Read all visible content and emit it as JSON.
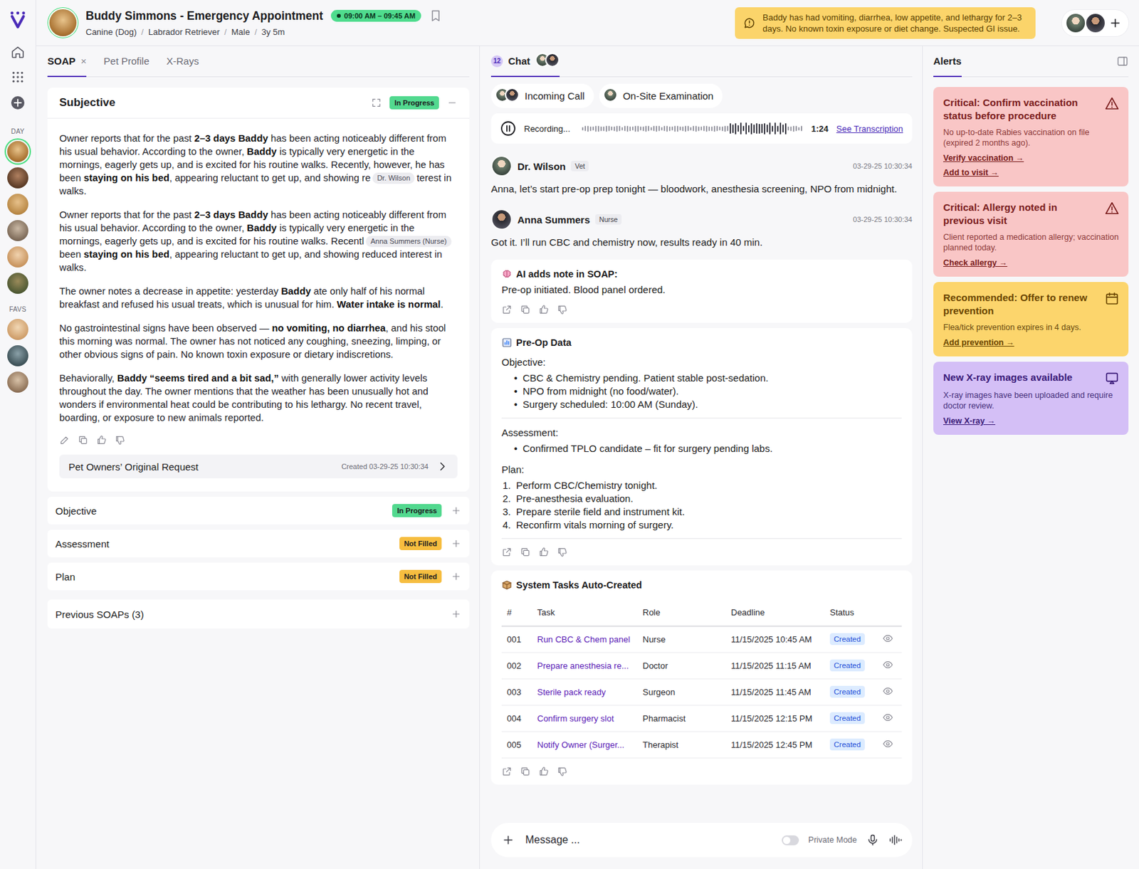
{
  "header": {
    "title": "Buddy Simmons - Emergency Appointment",
    "time": "09:00 AM – 09:45 AM",
    "bookmarked": false,
    "meta": [
      "Canine (Dog)",
      "Labrador Retriever",
      "Male",
      "3y 5m"
    ],
    "meta_separator": "/",
    "alert": "Baddy has had vomiting, diarrhea, low appetite, and lethargy for 2–3 days. No known toxin exposure or diet change. Suspected GI issue."
  },
  "rail": {
    "day_label": "DAY",
    "day": [
      {
        "selected": true
      },
      {
        "selected": false
      },
      {
        "selected": false
      },
      {
        "selected": false
      },
      {
        "selected": false
      },
      {
        "selected": false
      }
    ],
    "favs_label": "FAVS",
    "favs": [
      {
        "selected": false
      },
      {
        "selected": false
      },
      {
        "selected": false
      }
    ]
  },
  "soap_tabs": [
    {
      "label": "SOAP",
      "selected": true,
      "close": "×"
    },
    {
      "label": "Pet Profile",
      "selected": false
    },
    {
      "label": "X-Rays",
      "selected": false
    }
  ],
  "subjective": {
    "title": "Subjective",
    "status": "In Progress",
    "color": "#52d98f",
    "paragraphs": [
      [
        {
          "kind": "text",
          "text": "Owner reports that for the past "
        },
        {
          "kind": "bold",
          "text": "2–3 days Baddy"
        },
        {
          "kind": "text",
          "text": " has been acting noticeably different from his usual behavior. According to the owner, "
        },
        {
          "kind": "bold",
          "text": "Baddy"
        },
        {
          "kind": "text",
          "text": " is typically very energetic in the mornings, eagerly gets up, and is excited for his routine walks. Recently, however, he has been "
        },
        {
          "kind": "bold",
          "text": "staying on his bed"
        },
        {
          "kind": "text",
          "text": ", appearing reluctant to get up, and showing re"
        },
        {
          "kind": "cursor",
          "text": "Dr. Wilson"
        },
        {
          "kind": "text",
          "text": "terest in walks."
        }
      ],
      [
        {
          "kind": "text",
          "text": "Owner reports that for the past "
        },
        {
          "kind": "bold",
          "text": "2–3 days Baddy"
        },
        {
          "kind": "text",
          "text": " has been acting noticeably different from his usual behavior. According to the owner, "
        },
        {
          "kind": "bold",
          "text": "Baddy"
        },
        {
          "kind": "text",
          "text": " is typically very energetic in the mornings, eagerly gets up, and is excited for his routine walks. Recentl"
        },
        {
          "kind": "cursor",
          "text": "Anna Summers (Nurse)"
        },
        {
          "kind": "text",
          "text": "been "
        },
        {
          "kind": "bold",
          "text": "staying on his bed"
        },
        {
          "kind": "text",
          "text": ", appearing reluctant to get up, and showing reduced interest in walks."
        }
      ],
      [
        {
          "kind": "text",
          "text": "The owner notes a decrease in appetite: yesterday "
        },
        {
          "kind": "bold",
          "text": "Baddy"
        },
        {
          "kind": "text",
          "text": " ate only half of his normal breakfast and refused his usual treats, which is unusual for him. "
        },
        {
          "kind": "bold",
          "text": "Water intake is normal"
        },
        {
          "kind": "text",
          "text": "."
        }
      ],
      [
        {
          "kind": "text",
          "text": "No gastrointestinal signs have been observed — "
        },
        {
          "kind": "bold",
          "text": "no vomiting, no diarrhea"
        },
        {
          "kind": "text",
          "text": ", and his stool this morning was normal. The owner has not noticed any coughing, sneezing, limping, or other obvious signs of pain. No known toxin exposure or dietary indiscretions."
        }
      ],
      [
        {
          "kind": "text",
          "text": "Behaviorally, "
        },
        {
          "kind": "bold",
          "text": "Baddy “seems tired and a bit sad,”"
        },
        {
          "kind": "text",
          "text": " with generally lower activity levels throughout the day. The owner mentions that the weather has been unusually hot and wonders if environmental heat could be contributing to his lethargy. No recent travel, boarding, or exposure to new animals reported."
        }
      ]
    ],
    "original_request": {
      "label": "Pet Owners’ Original Request",
      "created": "Created 03-29-25 10:30:34"
    }
  },
  "sections": [
    {
      "title": "Objective",
      "status": "In Progress",
      "color": "#52d98f"
    },
    {
      "title": "Assessment",
      "status": "Not Filled",
      "color": "#f6bd3f"
    },
    {
      "title": "Plan",
      "status": "Not Filled",
      "color": "#f6bd3f"
    }
  ],
  "previous_soaps": {
    "title": "Previous SOAPs (3)"
  },
  "chat": {
    "tab": {
      "label": "Chat",
      "count": "12",
      "selected": true
    },
    "chips": [
      {
        "label": "Incoming Call"
      },
      {
        "label": "On-Site Examination"
      }
    ],
    "recording": {
      "label": "Recording...",
      "time": "1:24",
      "link": "See Transcription"
    },
    "messages": [
      {
        "author": "Dr. Wilson",
        "role": "Vet",
        "time": "03-29-25 10:30:34",
        "text": "Anna, let’s start pre-op prep tonight — bloodwork, anesthesia screening, NPO from midnight."
      },
      {
        "author": "Anna Summers",
        "role": "Nurse",
        "time": "03-29-25 10:30:34",
        "text": "Got it. I’ll run CBC and chemistry now, results ready in 40 min."
      }
    ],
    "ai_note": {
      "title": "AI adds note in SOAP:",
      "text": "Pre-op initiated. Blood panel ordered."
    },
    "preop": {
      "title": "Pre-Op Data",
      "sections": [
        {
          "heading": "Objective:",
          "items": [
            {
              "marker": "•",
              "text": "CBC & Chemistry pending. Patient stable post-sedation."
            },
            {
              "marker": "•",
              "text": "NPO from midnight (no food/water)."
            },
            {
              "marker": "•",
              "text": "Surgery scheduled: 10:00 AM (Sunday)."
            }
          ]
        },
        {
          "heading": "Assessment:",
          "items": [
            {
              "marker": "•",
              "text": "Confirmed TPLO candidate – fit for surgery pending labs."
            }
          ]
        },
        {
          "heading": "Plan:",
          "items": [
            {
              "marker": "1.",
              "text": "Perform CBC/Chemistry tonight."
            },
            {
              "marker": "2.",
              "text": "Pre-anesthesia evaluation."
            },
            {
              "marker": "3.",
              "text": "Prepare sterile field and instrument kit."
            },
            {
              "marker": "4.",
              "text": "Reconfirm vitals morning of surgery."
            }
          ]
        }
      ]
    },
    "tasks": {
      "title": "System Tasks Auto-Created",
      "columns": [
        "#",
        "Task",
        "Role",
        "Deadline",
        "Status"
      ],
      "rows": [
        {
          "num": "001",
          "task": "Run CBC & Chem panel",
          "role": "Nurse",
          "deadline": "11/15/2025 10:45 AM",
          "status": "Created"
        },
        {
          "num": "002",
          "task": "Prepare anesthesia re...",
          "role": "Doctor",
          "deadline": "11/15/2025 11:15 AM",
          "status": "Created"
        },
        {
          "num": "003",
          "task": "Sterile pack ready",
          "role": "Surgeon",
          "deadline": "11/15/2025 11:45 AM",
          "status": "Created"
        },
        {
          "num": "004",
          "task": "Confirm surgery slot",
          "role": "Pharmacist",
          "deadline": "11/15/2025 12:15 PM",
          "status": "Created"
        },
        {
          "num": "005",
          "task": "Notify Owner (Surger...",
          "role": "Therapist",
          "deadline": "11/15/2025 12:45 PM",
          "status": "Created"
        }
      ]
    },
    "composer": {
      "placeholder": "Message ...",
      "private_mode": {
        "label": "Private Mode",
        "on": false
      }
    }
  },
  "alerts": {
    "tab": {
      "label": "Alerts",
      "selected": true
    },
    "items": [
      {
        "kind": "critical",
        "title": "Critical: Confirm vaccination status before procedure",
        "body": "No up-to-date Rabies vaccination on file (expired 2 months ago).",
        "links": [
          "Verify vaccination →",
          "Add to visit →"
        ]
      },
      {
        "kind": "critical",
        "title": "Critical: Allergy noted in previous visit",
        "body": "Client reported a medication allergy; vaccination planned today.",
        "links": [
          "Check allergy →"
        ]
      },
      {
        "kind": "recommended",
        "title": "Recommended: Offer to renew prevention",
        "body": "Flea/tick prevention expires in 4 days.",
        "links": [
          "Add prevention →"
        ]
      },
      {
        "kind": "info",
        "title": "New X-ray images available",
        "body": "X-ray images have been uploaded and require doctor review.",
        "links": [
          "View X-ray →"
        ]
      }
    ]
  }
}
